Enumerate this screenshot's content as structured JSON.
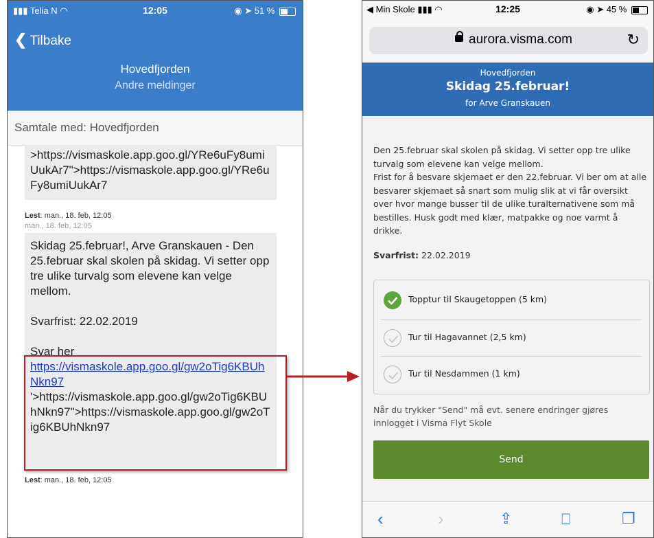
{
  "left": {
    "status": {
      "carrier": "Telia N",
      "time": "12:05",
      "battery": "51 %",
      "battery_level": 0.51
    },
    "back_label": "Tilbake",
    "title": "Hovedfjorden",
    "subtitle": "Andre meldinger",
    "conversation_label": "Samtale med: Hovedfjorden",
    "msg1_text": ">https://vismaskole.app.goo.gl/YRe6uFy8umiUukAr7\">https://vismaskole.app.goo.gl/YRe6uFy8umiUukAr7",
    "read1_label": "Lest",
    "read1_time": ": man., 18. feb, 12:05",
    "sent2_time": "man., 18. feb, 12:05",
    "msg2_text": "Skidag 25.februar!, Arve Granskauen - Den 25.februar skal skolen på skidag. Vi setter opp tre ulike turvalg som elevene kan velge mellom.",
    "msg2_deadline": "Svarfrist: 22.02.2019",
    "msg2_reply": "Svar her",
    "msg2_link": "https://vismaskole.app.goo.gl/gw2oTig6KBUhNkn97",
    "msg2_tail": "'>https://vismaskole.app.goo.gl/gw2oTig6KBUhNkn97\">https://vismaskole.app.goo.gl/gw2oTig6KBUhNkn97",
    "read2_label": "Lest",
    "read2_time": ": man., 18. feb, 12:05"
  },
  "right": {
    "status": {
      "carrier": "Min Skole",
      "time": "12:25",
      "battery": "45 %",
      "battery_level": 0.45
    },
    "url": "aurora.visma.com",
    "school": "Hovedfjorden",
    "heading": "Skidag 25.februar!",
    "for_label": "for Arve Granskauen",
    "description": "Den 25.februar skal skolen på skidag. Vi setter opp tre ulike turvalg som elevene kan velge mellom.\nFrist for å besvare skjemaet er den 22.februar. Vi ber om at alle besvarer skjemaet så snart som mulig slik at vi får oversikt over hvor mange busser til de ulike turalternativene som må bestilles. Husk godt med klær, matpakke og noe varmt å drikke.",
    "deadline_label": "Svarfrist:",
    "deadline_value": " 22.02.2019",
    "options": [
      {
        "label": "Topptur til Skaugetoppen (5 km)",
        "checked": true
      },
      {
        "label": "Tur til Hagavannet (2,5 km)",
        "checked": false
      },
      {
        "label": "Tur til Nesdammen (1 km)",
        "checked": false
      }
    ],
    "note": "Når du trykker \"Send\" må evt. senere endringer gjøres innlogget i Visma Flyt Skole",
    "send_label": "Send"
  },
  "colors": {
    "left_header": "#3a7dc9",
    "right_banner": "#2e6db4",
    "send": "#5a8a2c",
    "highlight": "#b31f24",
    "check_on": "#5aa53a"
  }
}
